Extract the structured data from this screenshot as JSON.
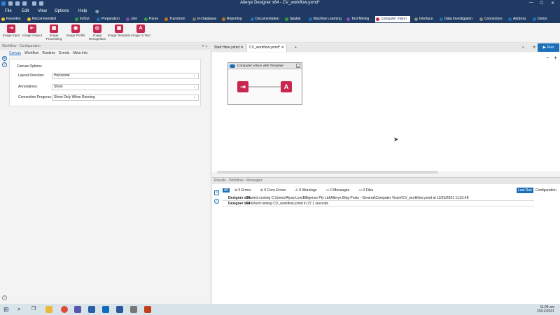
{
  "window": {
    "title": "Alteryx Designer x64 - CV_workflow.yxmd*"
  },
  "menu": {
    "items": [
      "File",
      "Edit",
      "View",
      "Options",
      "Help"
    ]
  },
  "search": {
    "value": "image"
  },
  "categories": [
    {
      "label": "Favorites",
      "color": "#f2c12e"
    },
    {
      "label": "Recommended",
      "color": "#f2c12e"
    },
    {
      "label": "In/Out",
      "color": "#2e9e3f"
    },
    {
      "label": "Preparation",
      "color": "#1c6fb9"
    },
    {
      "label": "Join",
      "color": "#8b4bb8"
    },
    {
      "label": "Parse",
      "color": "#2e9e3f"
    },
    {
      "label": "Transform",
      "color": "#c9701a"
    },
    {
      "label": "In-Database",
      "color": "#555"
    },
    {
      "label": "Reporting",
      "color": "#c9701a"
    },
    {
      "label": "Documentation",
      "color": "#1c6fb9"
    },
    {
      "label": "Spatial",
      "color": "#2e9e3f"
    },
    {
      "label": "Machine Learning",
      "color": "#1c6fb9"
    },
    {
      "label": "Text Mining",
      "color": "#8b4bb8"
    },
    {
      "label": "Computer Vision",
      "color": "#c8274f"
    },
    {
      "label": "Interface",
      "color": "#555"
    },
    {
      "label": "Data Investigation",
      "color": "#1c6fb9"
    },
    {
      "label": "Connectors",
      "color": "#555"
    },
    {
      "label": "Address",
      "color": "#1c6fb9"
    },
    {
      "label": "Demo",
      "color": "#1c6fb9"
    }
  ],
  "tools": [
    "Image Input",
    "Image Output",
    "Image Processing",
    "Image Profile",
    "Image Recognition",
    "Image Template",
    "Image to Text"
  ],
  "config": {
    "header": "Workflow - Configuration",
    "tabs": [
      "Canvas",
      "Workflow",
      "Runtime",
      "Events",
      "Meta Info"
    ],
    "section": "Canvas Options",
    "rows": [
      {
        "label": "Layout Direction:",
        "value": "Horizontal"
      },
      {
        "label": "Annotations:",
        "value": "Show"
      },
      {
        "label": "Connection Progress:",
        "value": "Show Only When Running"
      }
    ]
  },
  "doc_tabs": [
    "Start Here.yxmd",
    "CV_workflow.yxmd*"
  ],
  "run_label": "Run",
  "container": {
    "title": "Computer Vision with Template"
  },
  "results": {
    "header": "Results - Workflow - Messages",
    "all": "All",
    "counts": [
      "0 Errors",
      "0 Conv Errors",
      "0 Warnings",
      "0 Messages",
      "0 Files"
    ],
    "tabs": [
      "Last Run",
      "Configuration"
    ],
    "messages": [
      {
        "source": "Designer x64",
        "text": "Started running C:\\Users\\Alysa Low\\Billigence Pty Ltd\\Alteryx Blog Posts - General\\Computer Vision\\CV_workflow.yxmd at 12/23/2021 11:01:48"
      },
      {
        "source": "Designer x64",
        "text": "Finished running CV_workflow.yxmd in 27.1 seconds"
      }
    ]
  },
  "clock": {
    "time": "11:04 am",
    "date": "23/12/2021"
  }
}
